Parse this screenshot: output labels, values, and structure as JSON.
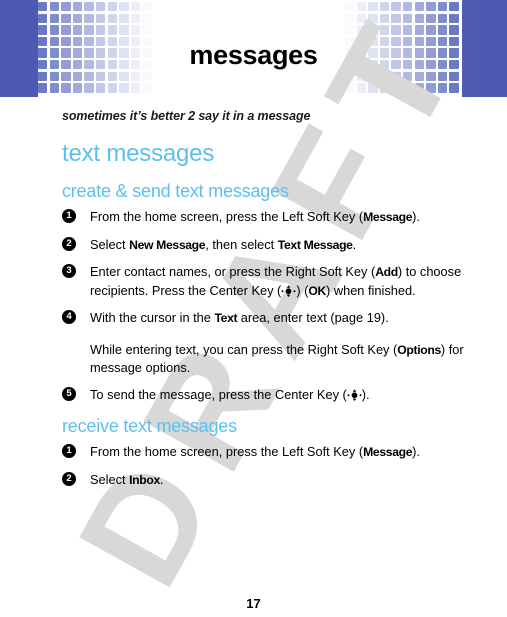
{
  "header": {
    "title": "messages",
    "band_color_dark": "#4a58b0",
    "band_color_light": "#5a68ba",
    "square_color": "#6b78c4"
  },
  "watermark": {
    "text": "DRAFT",
    "color": "#d8d8d8"
  },
  "accent_color": "#5bc0ee",
  "lede": "sometimes it’s better 2 say it in a message",
  "chapter_title": "text messages",
  "sections": [
    {
      "heading": "create & send text messages",
      "steps": [
        {
          "number": "1",
          "parts": [
            {
              "t": "From the home screen, press the Left Soft Key (",
              "bold": false
            },
            {
              "t": "Message",
              "bold": true
            },
            {
              "t": ").",
              "bold": false
            }
          ]
        },
        {
          "number": "2",
          "parts": [
            {
              "t": "Select ",
              "bold": false
            },
            {
              "t": "New Message",
              "bold": true
            },
            {
              "t": ", then select ",
              "bold": false
            },
            {
              "t": "Text Message",
              "bold": true
            },
            {
              "t": ".",
              "bold": false
            }
          ]
        },
        {
          "number": "3",
          "parts": [
            {
              "t": "Enter contact names, or press the Right Soft Key (",
              "bold": false
            },
            {
              "t": "Add",
              "bold": true
            },
            {
              "t": ") to choose recipients. Press the Center Key (",
              "bold": false
            },
            {
              "t": "",
              "navkey": true
            },
            {
              "t": ") (",
              "bold": false
            },
            {
              "t": "OK",
              "bold": true
            },
            {
              "t": ") when finished.",
              "bold": false
            }
          ]
        },
        {
          "number": "4",
          "parts": [
            {
              "t": "With the cursor in the ",
              "bold": false
            },
            {
              "t": "Text",
              "bold": true
            },
            {
              "t": " area, enter text (page 19).",
              "bold": false
            }
          ],
          "continuation": [
            {
              "t": "While entering text, you can press the Right Soft Key (",
              "bold": false
            },
            {
              "t": "Options",
              "bold": true
            },
            {
              "t": ") for message options.",
              "bold": false
            }
          ]
        },
        {
          "number": "5",
          "parts": [
            {
              "t": "To send the message, press the Center Key (",
              "bold": false
            },
            {
              "t": "",
              "navkey": true
            },
            {
              "t": ").",
              "bold": false
            }
          ]
        }
      ]
    },
    {
      "heading": "receive text messages",
      "steps": [
        {
          "number": "1",
          "parts": [
            {
              "t": "From the home screen, press the Left Soft Key (",
              "bold": false
            },
            {
              "t": "Message",
              "bold": true
            },
            {
              "t": ").",
              "bold": false
            }
          ]
        },
        {
          "number": "2",
          "parts": [
            {
              "t": "Select ",
              "bold": false
            },
            {
              "t": "Inbox",
              "bold": true
            },
            {
              "t": ".",
              "bold": false
            }
          ]
        }
      ]
    }
  ],
  "page_number": "17"
}
